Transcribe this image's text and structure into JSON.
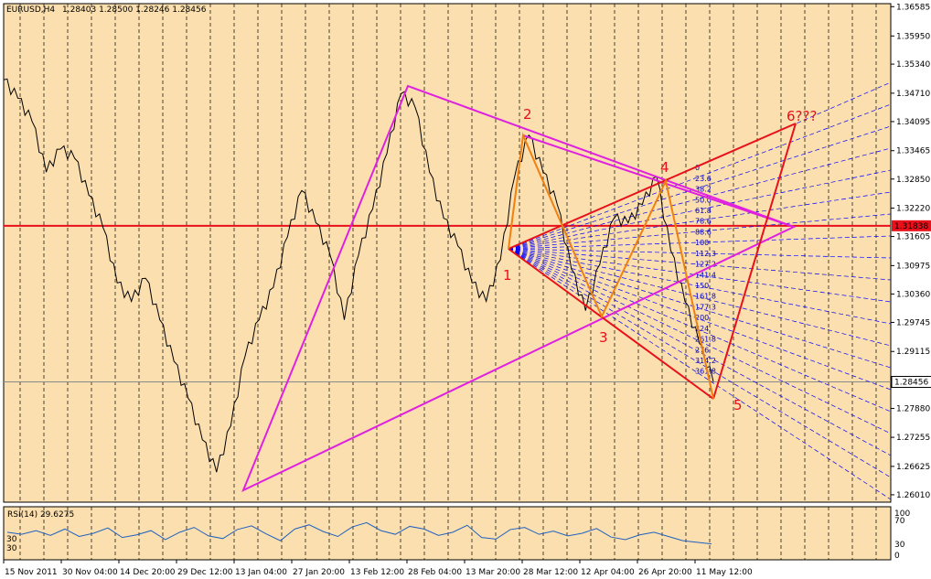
{
  "header": {
    "symbol": "EURUSD,H4",
    "ohlc": "1.28403 1.28500 1.28246 1.28456"
  },
  "rsi": {
    "label": "RSI(14) 29.6275",
    "levels": [
      "100",
      "70",
      "30",
      "0"
    ],
    "left_levels": [
      "30",
      "30"
    ]
  },
  "colors": {
    "background": "#fbdfae",
    "pattern": "#e020e0",
    "triangle": "#e8101a",
    "wave": "#f08010",
    "fan": "#0000ff",
    "current_price": "#e8101a",
    "candles": "#000000"
  },
  "chart_data": {
    "type": "line",
    "price_axis": {
      "ticks": [
        "1.36585",
        "1.35950",
        "1.35340",
        "1.34710",
        "1.34095",
        "1.33465",
        "1.32850",
        "1.32220",
        "1.31605",
        "1.30975",
        "1.30360",
        "1.29745",
        "1.29115",
        "1.28500",
        "1.27880",
        "1.27255",
        "1.26625",
        "1.26010"
      ],
      "range": [
        1.2585,
        1.3665
      ],
      "current_level": "1.31838",
      "last_price": "1.28456"
    },
    "time_axis": {
      "ticks": [
        "15 Nov 2011",
        "30 Nov 04:00",
        "14 Dec 20:00",
        "29 Dec 12:00",
        "13 Jan 04:00",
        "27 Jan 20:00",
        "13 Feb 12:00",
        "28 Feb 04:00",
        "13 Mar 20:00",
        "28 Mar 12:00",
        "12 Apr 04:00",
        "26 Apr 20:00",
        "11 May 12:00"
      ]
    },
    "price_path": [
      [
        0,
        1.35
      ],
      [
        2,
        1.346
      ],
      [
        4,
        1.341
      ],
      [
        6,
        1.33
      ],
      [
        8,
        1.335
      ],
      [
        10,
        1.333
      ],
      [
        12,
        1.325
      ],
      [
        14,
        1.318
      ],
      [
        16,
        1.306
      ],
      [
        18,
        1.302
      ],
      [
        20,
        1.307
      ],
      [
        22,
        1.298
      ],
      [
        24,
        1.289
      ],
      [
        26,
        1.281
      ],
      [
        28,
        1.272
      ],
      [
        30,
        1.265
      ],
      [
        32,
        1.275
      ],
      [
        34,
        1.29
      ],
      [
        36,
        1.298
      ],
      [
        38,
        1.305
      ],
      [
        40,
        1.316
      ],
      [
        42,
        1.326
      ],
      [
        44,
        1.319
      ],
      [
        46,
        1.312
      ],
      [
        48,
        1.298
      ],
      [
        50,
        1.312
      ],
      [
        52,
        1.322
      ],
      [
        54,
        1.334
      ],
      [
        56,
        1.347
      ],
      [
        58,
        1.344
      ],
      [
        60,
        1.33
      ],
      [
        62,
        1.32
      ],
      [
        64,
        1.314
      ],
      [
        66,
        1.306
      ],
      [
        68,
        1.302
      ],
      [
        70,
        1.311
      ],
      [
        72,
        1.329
      ],
      [
        74,
        1.338
      ],
      [
        76,
        1.33
      ],
      [
        78,
        1.323
      ],
      [
        80,
        1.309
      ],
      [
        82,
        1.3
      ],
      [
        84,
        1.31
      ],
      [
        86,
        1.32
      ],
      [
        88,
        1.319
      ],
      [
        90,
        1.323
      ],
      [
        92,
        1.329
      ],
      [
        94,
        1.313
      ],
      [
        96,
        1.302
      ],
      [
        98,
        1.293
      ],
      [
        100,
        1.2846
      ]
    ],
    "rsi_values": [
      52,
      48,
      55,
      46,
      58,
      44,
      50,
      60,
      42,
      47,
      55,
      38,
      52,
      61,
      45,
      40,
      57,
      64,
      49,
      36,
      58,
      66,
      53,
      44,
      62,
      70,
      55,
      48,
      63,
      58,
      46,
      52,
      65,
      42,
      39,
      57,
      61,
      48,
      54,
      45,
      50,
      59,
      43,
      38,
      47,
      52,
      44,
      36,
      33,
      30
    ],
    "wave_labels": [
      "1",
      "2",
      "3",
      "4",
      "5",
      "6???"
    ],
    "fib_levels": [
      "0",
      "23.6",
      "38.2",
      "50.0",
      "61.8",
      "78.6",
      "88.6",
      "100",
      "112.3",
      "127.2",
      "141.4",
      "150",
      "161.8",
      "177.3",
      "200",
      "224",
      "261.8",
      "276",
      "314.2",
      "361.8"
    ]
  }
}
